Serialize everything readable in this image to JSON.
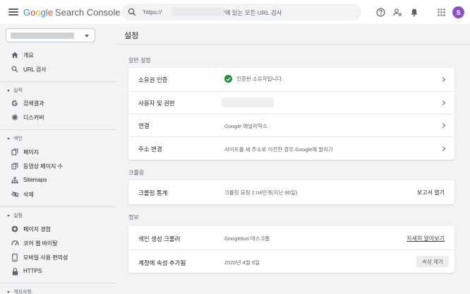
{
  "header": {
    "logo_word": [
      "G",
      "o",
      "o",
      "g",
      "l",
      "e"
    ],
    "product": "Search Console",
    "search_text": "'https://",
    "search_suffix": "'에 있는 모든 URL 검사",
    "avatar_letter": "S"
  },
  "sidebar": {
    "items": [
      {
        "label": "개요",
        "icon": "home-icon"
      },
      {
        "label": "URL 검사",
        "icon": "search-icon"
      }
    ],
    "sections": [
      {
        "title": "실적",
        "items": [
          {
            "label": "검색결과",
            "icon": "google-g-icon"
          },
          {
            "label": "디스커버",
            "icon": "asterisk-icon"
          }
        ]
      },
      {
        "title": "색인",
        "items": [
          {
            "label": "페이지",
            "icon": "pages-icon"
          },
          {
            "label": "동영상 페이지 수",
            "icon": "video-pages-icon"
          },
          {
            "label": "Sitemaps",
            "icon": "sitemap-icon"
          },
          {
            "label": "삭제",
            "icon": "eye-off-icon"
          }
        ]
      },
      {
        "title": "실험",
        "items": [
          {
            "label": "페이지 경험",
            "icon": "plus-circle-icon"
          },
          {
            "label": "코어 웹 바이탈",
            "icon": "speed-icon"
          },
          {
            "label": "모바일 사용 편의성",
            "icon": "mobile-icon"
          },
          {
            "label": "HTTPS",
            "icon": "lock-icon"
          }
        ]
      },
      {
        "title": "개선사항"
      }
    ]
  },
  "main": {
    "title": "설정",
    "general": {
      "label": "일반 설정",
      "rows": [
        {
          "key": "소유권 인증",
          "value": "인증된 소유자입니다."
        },
        {
          "key": "사용자 및 권한",
          "value": ""
        },
        {
          "key": "연결",
          "value": "Google 애널리틱스"
        },
        {
          "key": "주소 변경",
          "value": "사이트를 새 주소로 이전한 경우 Google에 알리기"
        }
      ]
    },
    "crawling": {
      "label": "크롤링",
      "row": {
        "key": "크롤링 통계",
        "value": "크롤링 요청 2.04만개(지난 90일)",
        "action": "보고서 열기"
      }
    },
    "about": {
      "label": "정보",
      "rows": [
        {
          "key": "색인 생성 크롤러",
          "value": "Googlebot 데스크톱",
          "action": "자세히 알아보기"
        },
        {
          "key": "계정에 속성 추가됨",
          "value": "2020년 4월 6일",
          "action": "속성 제거"
        }
      ]
    }
  },
  "colors": {
    "accent_green": "#1e8e3e",
    "avatar": "#8e4fc8"
  }
}
